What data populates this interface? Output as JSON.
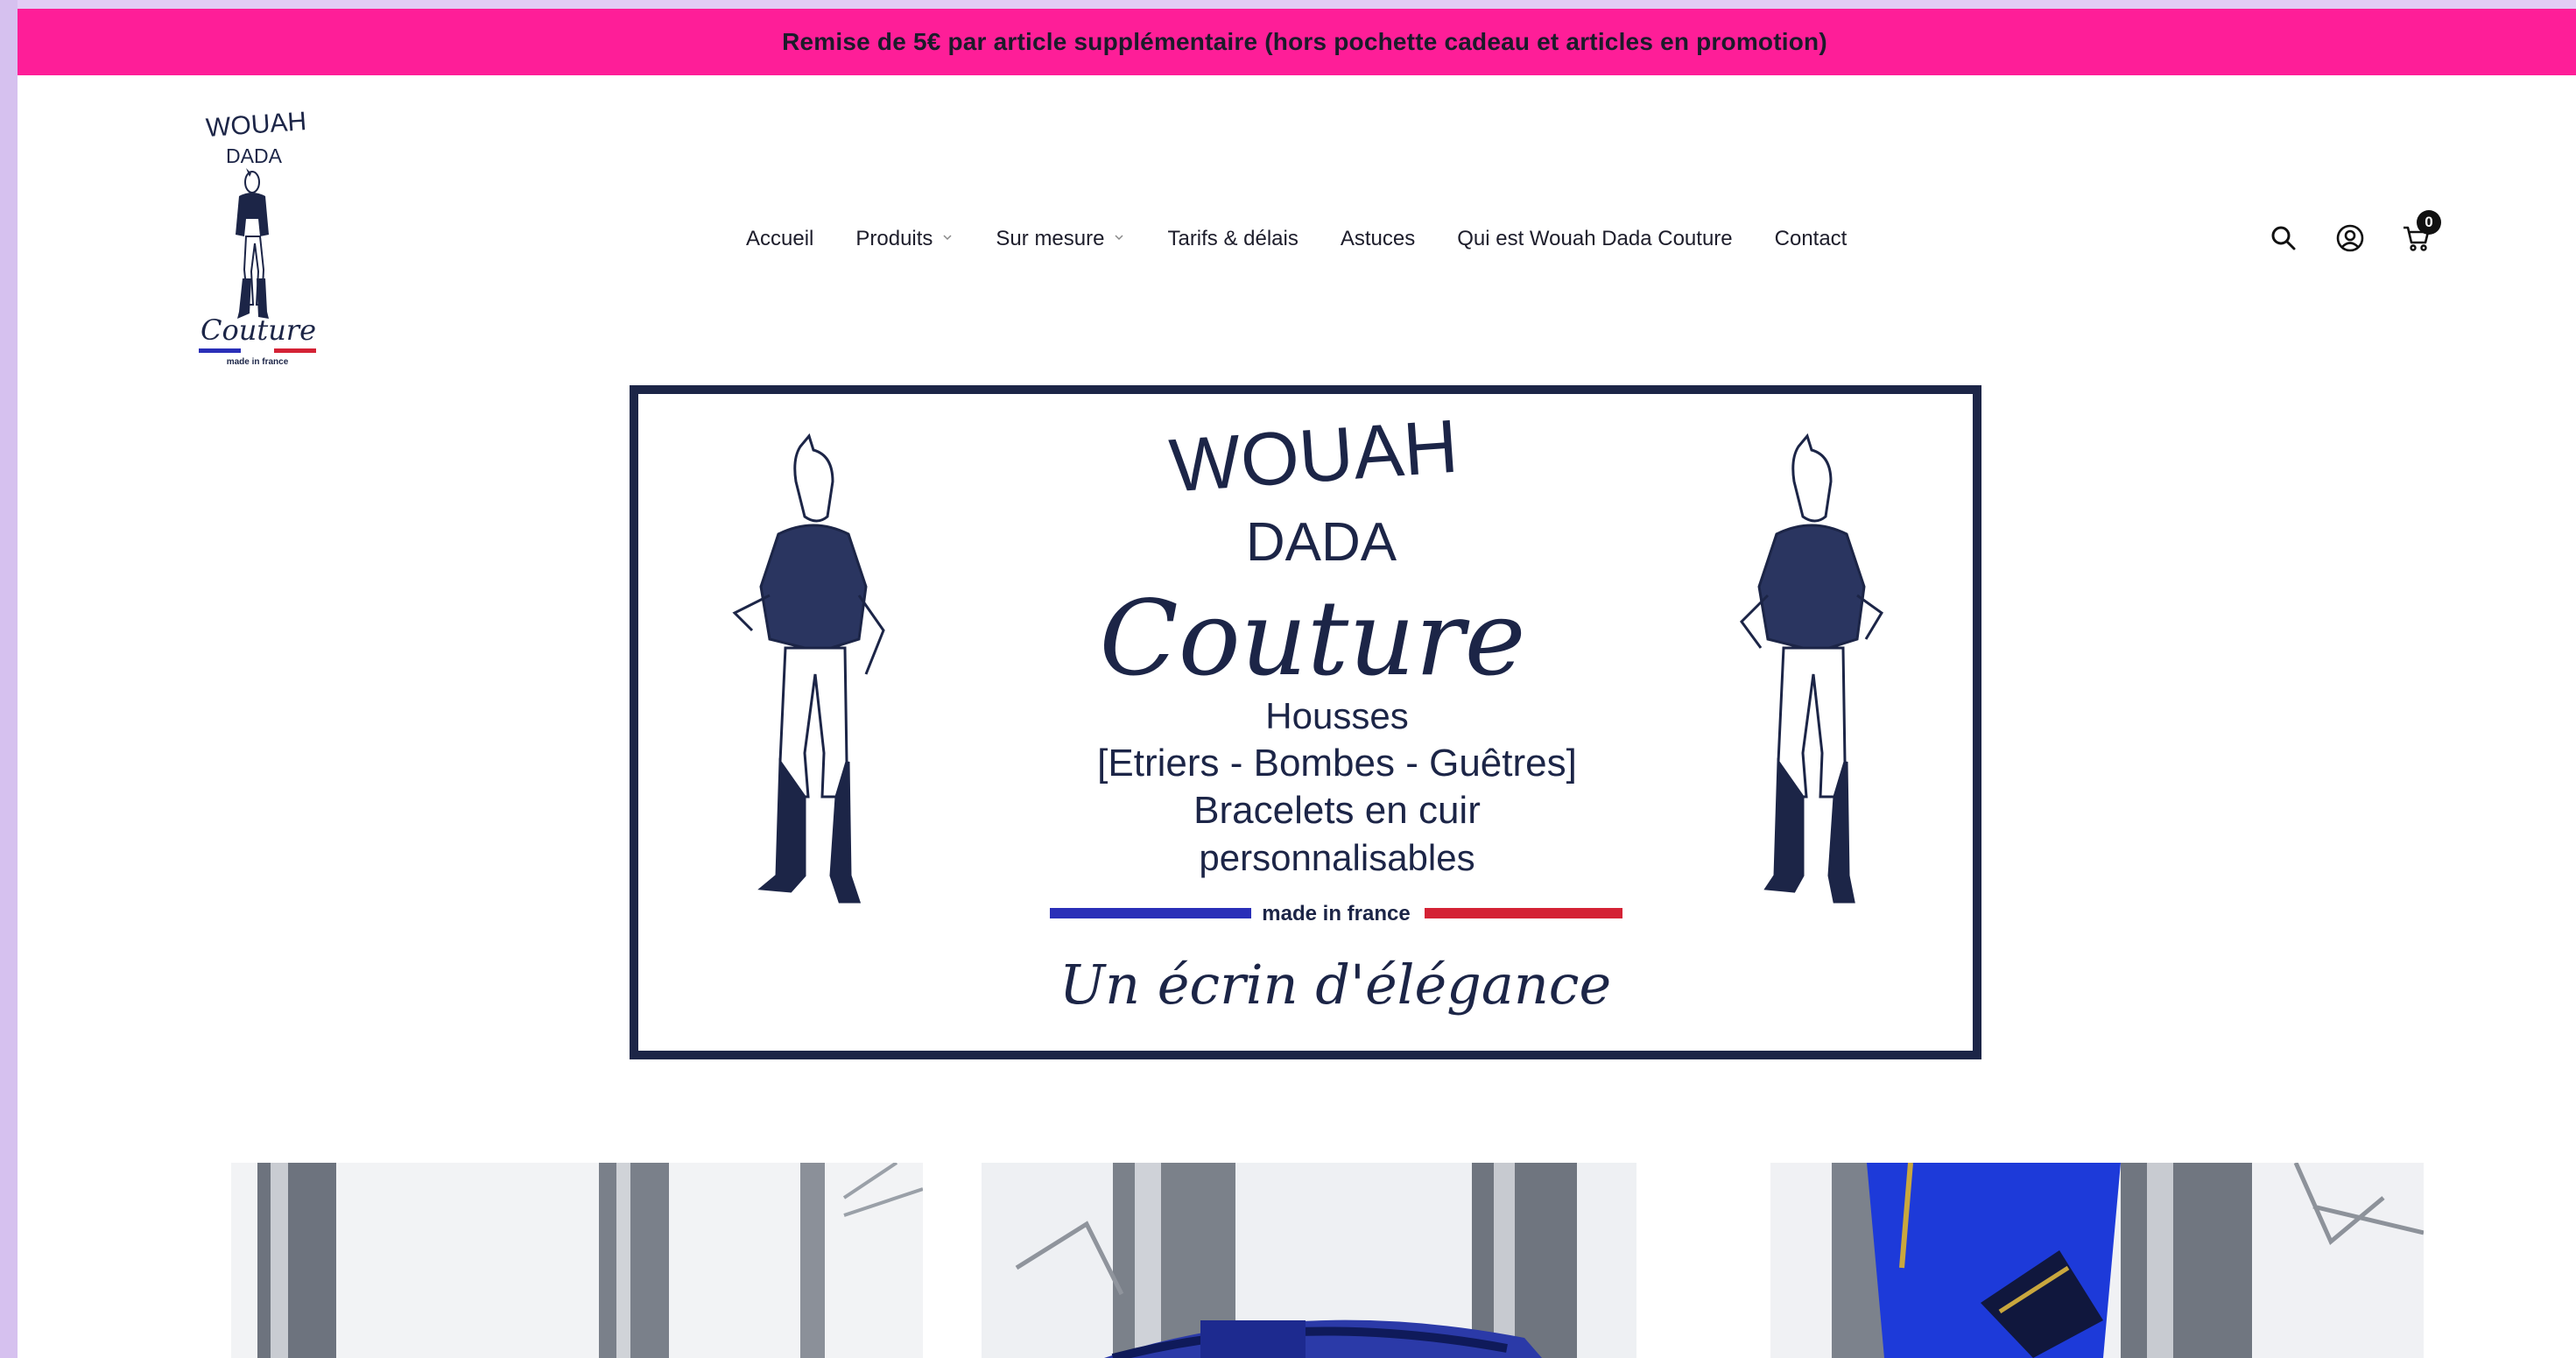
{
  "announcement": {
    "text": "Remise de 5€ par article supplémentaire (hors pochette cadeau et articles en promotion)",
    "background": "#fe1e98"
  },
  "logo": {
    "line1": "WOUAH",
    "line2": "DADA",
    "line3": "Couture",
    "tagline": "made in france"
  },
  "nav": {
    "items": [
      {
        "label": "Accueil",
        "has_dropdown": false
      },
      {
        "label": "Produits",
        "has_dropdown": true
      },
      {
        "label": "Sur mesure",
        "has_dropdown": true
      },
      {
        "label": "Tarifs & délais",
        "has_dropdown": false
      },
      {
        "label": "Astuces",
        "has_dropdown": false
      },
      {
        "label": "Qui est Wouah Dada Couture",
        "has_dropdown": false
      },
      {
        "label": "Contact",
        "has_dropdown": false
      }
    ]
  },
  "header_icons": {
    "search": "search-icon",
    "account": "user-icon",
    "cart": "cart-icon",
    "cart_count": "0"
  },
  "banner": {
    "brand_line1": "WOUAH",
    "brand_line2": "DADA",
    "brand_line3": "Couture",
    "line_housses": "Housses",
    "line_items": "[Etriers - Bombes - Guêtres]",
    "line_bracelets": "Bracelets en cuir",
    "line_perso": "personnalisables",
    "made_in": "made in france",
    "slogan": "Un écrin d'élégance",
    "navy": "#1c2547",
    "flag_blue": "#2a2fb8",
    "flag_red": "#d42235"
  }
}
